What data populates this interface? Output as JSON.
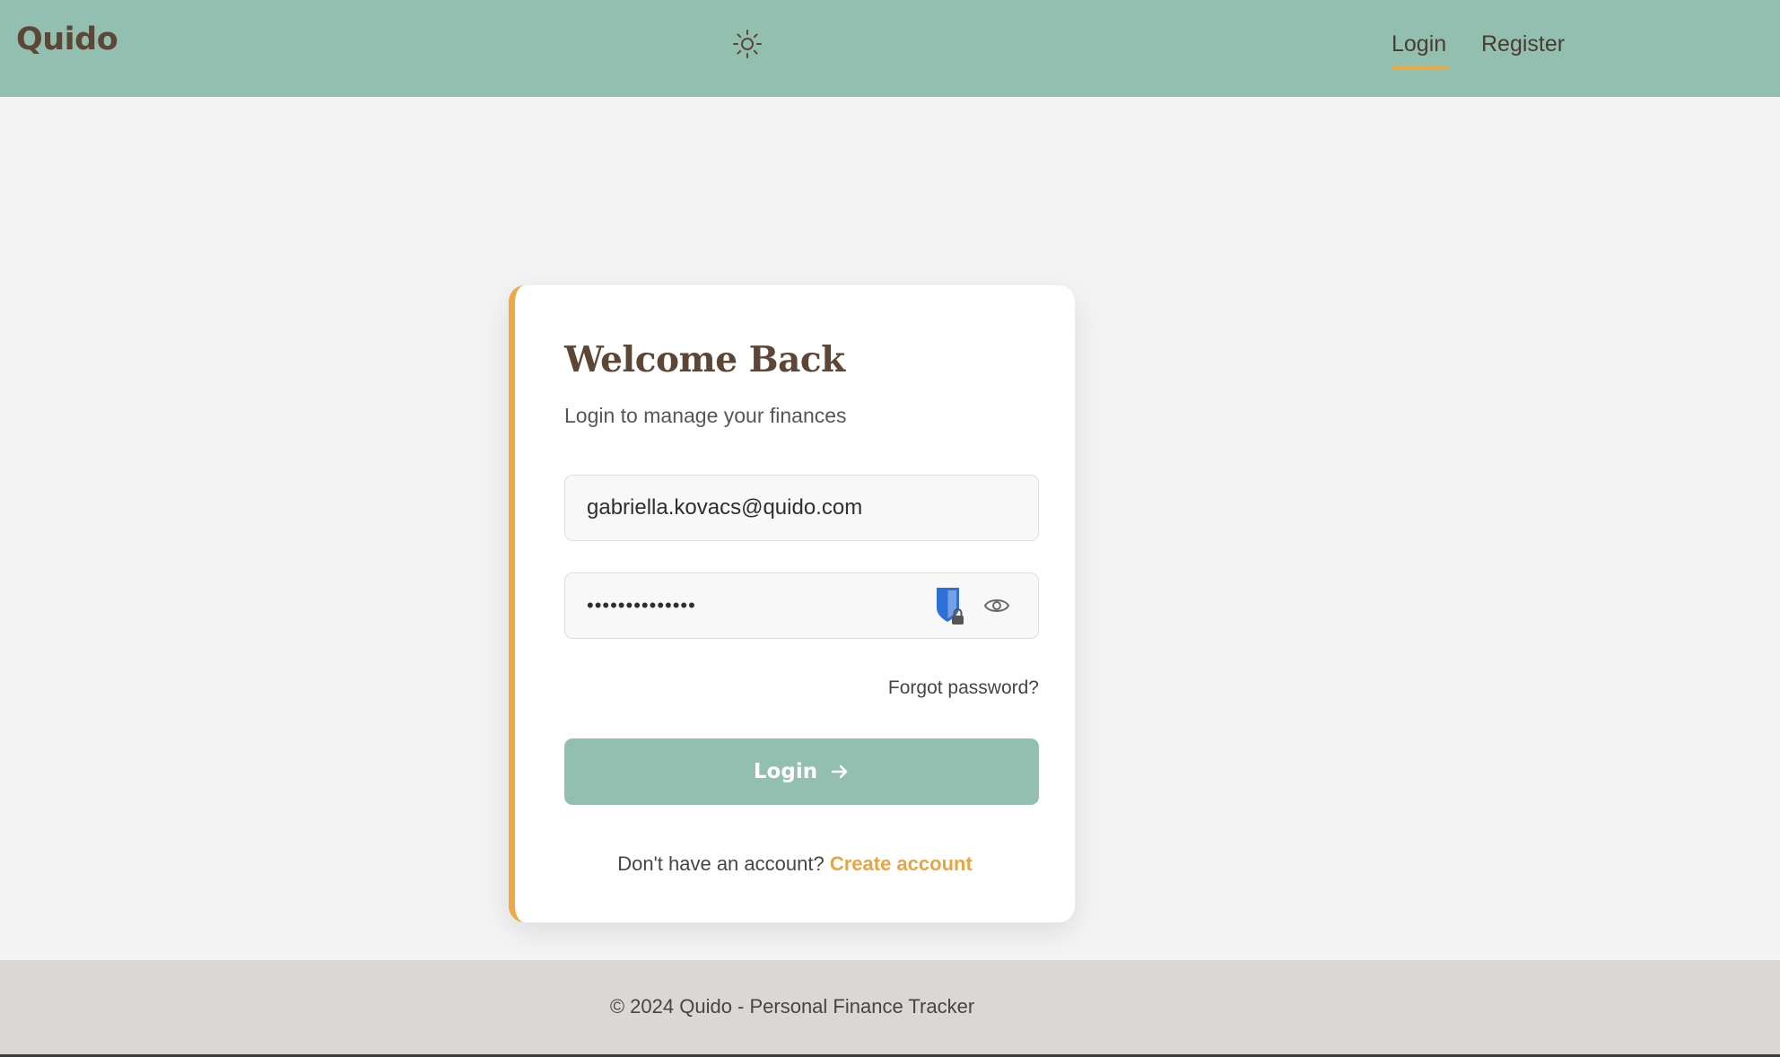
{
  "navbar": {
    "brand": "Quido",
    "theme_icon": "sun-icon",
    "links": [
      {
        "label": "Login",
        "active": true
      },
      {
        "label": "Register",
        "active": false
      }
    ],
    "accent_color": "#e9a944",
    "background": "#93bfb1"
  },
  "login_card": {
    "title": "Welcome Back",
    "subtitle": "Login to manage your finances",
    "email": {
      "value": "gabriella.kovacs@quido.com"
    },
    "password": {
      "masked_value": "••••••••••••••",
      "manager_icon": "password-manager-shield-icon",
      "toggle_icon": "eye-icon"
    },
    "forgot_password": "Forgot password?",
    "login_button": {
      "label": "Login",
      "icon": "arrow-right-icon"
    },
    "signup_prompt": "Don't have an account?",
    "signup_link": "Create account",
    "accent_color": "#eda848"
  },
  "footer": {
    "text": "© 2024 Quido - Personal Finance Tracker"
  }
}
